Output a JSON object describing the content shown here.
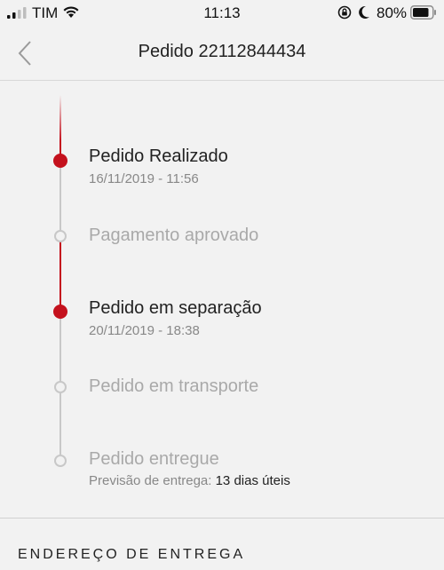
{
  "status_bar": {
    "carrier": "TIM",
    "time": "11:13",
    "battery": "80%",
    "icons": [
      "signal-icon",
      "wifi-icon",
      "orientation-lock-icon",
      "moon-icon",
      "battery-icon"
    ]
  },
  "header": {
    "title": "Pedido 22112844434",
    "back_icon": "chevron-left-icon"
  },
  "timeline": {
    "accent_color": "#c4111d",
    "pending_color": "#c8c8c8",
    "steps": [
      {
        "title": "Pedido Realizado",
        "date": "16/11/2019 - 11:56",
        "done": true
      },
      {
        "title": "Pagamento aprovado",
        "done": false
      },
      {
        "title": "Pedido em separação",
        "date": "20/11/2019 - 18:38",
        "done": true
      },
      {
        "title": "Pedido em transporte",
        "done": false
      },
      {
        "title": "Pedido entregue",
        "done": false,
        "forecast_label": "Previsão de entrega:",
        "forecast_value": "13 dias úteis"
      }
    ]
  },
  "section": {
    "delivery_address_title": "ENDEREÇO DE ENTREGA"
  }
}
